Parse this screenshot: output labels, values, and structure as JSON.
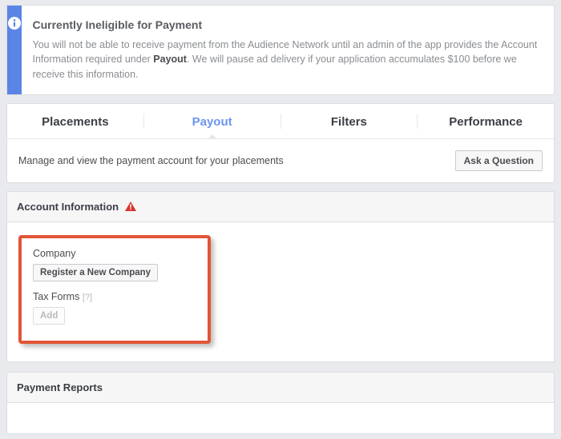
{
  "notice": {
    "title": "Currently Ineligible for Payment",
    "body_before": "You will not be able to receive payment from the Audience Network until an admin of the app provides the Account Information required under ",
    "payout_word": "Payout",
    "body_after": ". We will pause ad delivery if your application accumulates $100 before we receive this information."
  },
  "tabs": {
    "placements": "Placements",
    "payout": "Payout",
    "filters": "Filters",
    "performance": "Performance"
  },
  "subbar": {
    "description": "Manage and view the payment account for your placements",
    "ask_button": "Ask a Question"
  },
  "account_info": {
    "header": "Account Information",
    "company_label": "Company",
    "register_button": "Register a New Company",
    "tax_label": "Tax Forms",
    "tax_help": "[?]",
    "add_button": "Add"
  },
  "payment_reports": {
    "header": "Payment Reports"
  }
}
